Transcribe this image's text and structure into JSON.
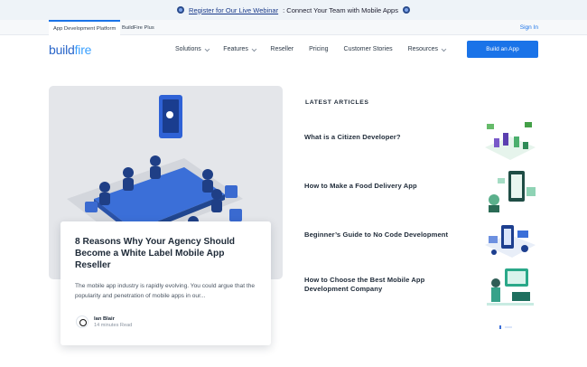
{
  "announcement": {
    "link_text": "Register for Our Live Webinar",
    "rest_text": ": Connect Your Team with Mobile Apps"
  },
  "subbar": {
    "tabs": [
      "App Development Platform",
      "BuildFire Plus"
    ],
    "sign_in": "Sign In"
  },
  "brand": {
    "logo_part1": "build",
    "logo_part2": "fire"
  },
  "nav": {
    "items": [
      {
        "label": "Solutions",
        "has_dropdown": true
      },
      {
        "label": "Features",
        "has_dropdown": true
      },
      {
        "label": "Reseller",
        "has_dropdown": false
      },
      {
        "label": "Pricing",
        "has_dropdown": false
      },
      {
        "label": "Customer Stories",
        "has_dropdown": false
      },
      {
        "label": "Resources",
        "has_dropdown": true
      }
    ],
    "cta": "Build an App"
  },
  "featured": {
    "title": "8 Reasons Why Your Agency Should Become a White Label Mobile App Reseller",
    "excerpt": "The mobile app industry is rapidly evolving. You could argue that the popularity and penetration of mobile apps in our...",
    "author": "Ian Blair",
    "read_time": "14 minutes Read"
  },
  "latest": {
    "heading": "LATEST ARTICLES",
    "articles": [
      {
        "title": "What is a Citizen Developer?"
      },
      {
        "title": "How to Make a Food Delivery App"
      },
      {
        "title": "Beginner’s Guide to No Code Development"
      },
      {
        "title": "How to Choose the Best Mobile App Development Company"
      }
    ]
  },
  "colors": {
    "accent": "#1a73e8",
    "heading": "#1e2a38"
  }
}
